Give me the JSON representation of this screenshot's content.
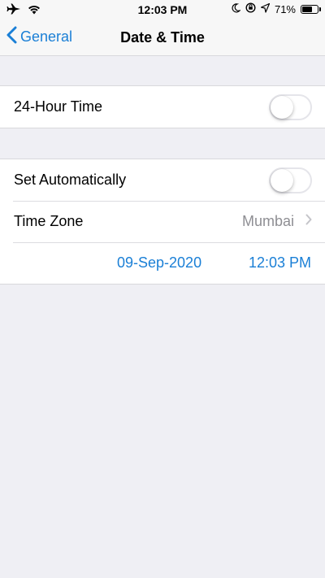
{
  "status_bar": {
    "time": "12:03 PM",
    "battery": "71%",
    "battery_level": 0.71,
    "icons": [
      "airplane-icon",
      "wifi-icon",
      "moon-icon",
      "rotation-lock-icon",
      "location-icon",
      "battery-icon"
    ]
  },
  "nav": {
    "back_label": "General",
    "title": "Date & Time"
  },
  "settings": {
    "hour24": {
      "label": "24-Hour Time",
      "enabled": false
    },
    "set_automatically": {
      "label": "Set Automatically",
      "enabled": false
    },
    "time_zone": {
      "label": "Time Zone",
      "value": "Mumbai"
    },
    "date": "09-Sep-2020",
    "time": "12:03 PM"
  },
  "colors": {
    "accent": "#1a7fd6",
    "background": "#efeff4",
    "secondary_text": "#8e8e93"
  }
}
